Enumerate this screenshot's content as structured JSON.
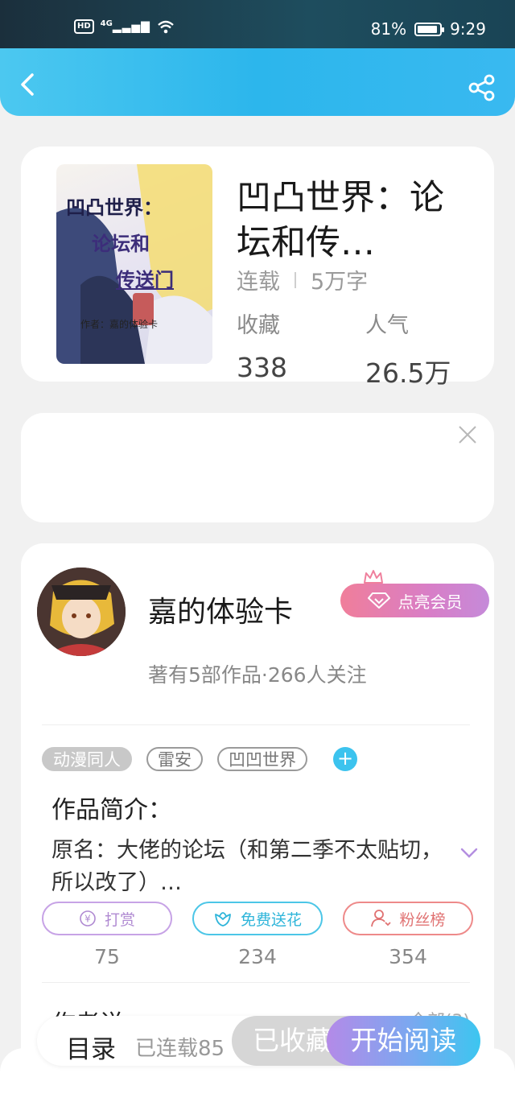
{
  "status_bar": {
    "hd": "HD",
    "network": "4G",
    "battery_percent": "81%",
    "battery_level": 0.81,
    "time": "9:29"
  },
  "header": {
    "back_icon": "chevron-left-icon",
    "share_icon": "share-icon"
  },
  "book": {
    "title": "凹凸世界：论坛和传…",
    "status": "连载",
    "word_count": "5万字",
    "favorites_label": "收藏",
    "favorites_value": "338",
    "popularity_label": "人气",
    "popularity_value": "26.5万",
    "cover_text_line1": "凹凸世界：",
    "cover_text_line2": "论坛和",
    "cover_text_line3": "传送门",
    "cover_author": "作者：嘉的体验卡"
  },
  "author": {
    "name": "嘉的体验卡",
    "vip_label": "点亮会员",
    "stats": "著有5部作品·266人关注"
  },
  "tags": [
    "动漫同人",
    "雷安",
    "凹凹世界"
  ],
  "intro": {
    "title": "作品简介：",
    "text": "原名：大佬的论坛（和第二季不太贴切，所以改了）…"
  },
  "actions": [
    {
      "label": "打赏",
      "count": "75",
      "icon": "yen-icon"
    },
    {
      "label": "免费送花",
      "count": "234",
      "icon": "flower-icon"
    },
    {
      "label": "粉丝榜",
      "count": "354",
      "icon": "user-icon"
    }
  ],
  "author_says": {
    "title": "作者说",
    "all": "全部(3)"
  },
  "bottom_bar": {
    "toc_label": "目录",
    "serial_label": "已连载85",
    "fav_label": "已收藏",
    "read_label": "开始阅读"
  },
  "colors": {
    "header": "#2cb6ec",
    "vip_gradient_start": "#f07e9a",
    "vip_gradient_end": "#c58ad9",
    "read_gradient_start": "#b48ae8",
    "read_gradient_end": "#3cc6f0"
  }
}
